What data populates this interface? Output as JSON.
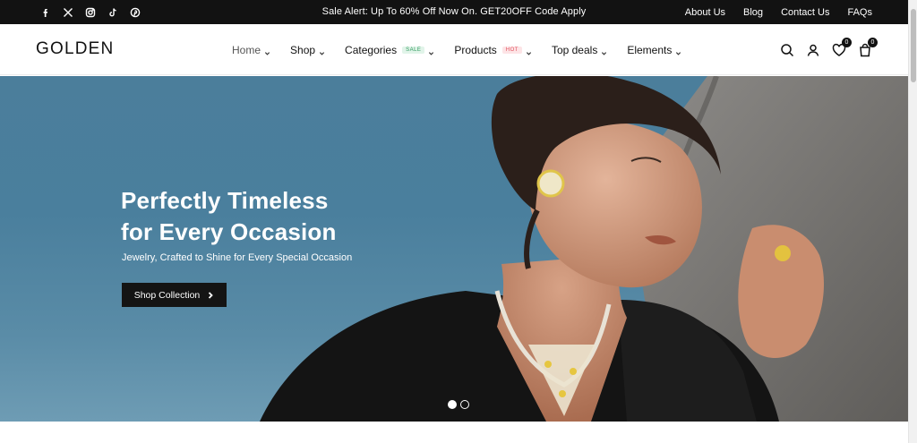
{
  "topbar": {
    "social": [
      "facebook-icon",
      "x-icon",
      "instagram-icon",
      "tiktok-icon",
      "pinterest-icon"
    ],
    "alert": "Sale Alert: Up To 60% Off Now On. GET20OFF Code Apply",
    "links": [
      "About Us",
      "Blog",
      "Contact Us",
      "FAQs"
    ]
  },
  "header": {
    "logo": "GOLDEN",
    "nav": [
      {
        "label": "Home",
        "badge": ""
      },
      {
        "label": "Shop",
        "badge": ""
      },
      {
        "label": "Categories",
        "badge": "SALE"
      },
      {
        "label": "Products",
        "badge": "HOT"
      },
      {
        "label": "Top deals",
        "badge": ""
      },
      {
        "label": "Elements",
        "badge": ""
      }
    ],
    "wishlist_count": "0",
    "cart_count": "0"
  },
  "hero": {
    "title_line1": "Perfectly Timeless",
    "title_line2": "for Every Occasion",
    "subtitle": "Jewelry, Crafted to Shine for Every Special Occasion",
    "button_label": "Shop Collection",
    "slides": 2,
    "active_slide": 1
  },
  "colors": {
    "topbar_bg": "#121212",
    "hero_sky": "#4b7e9b",
    "button_bg": "#141414",
    "sale_badge": "#2f9a5e",
    "hot_badge": "#e0525e"
  }
}
